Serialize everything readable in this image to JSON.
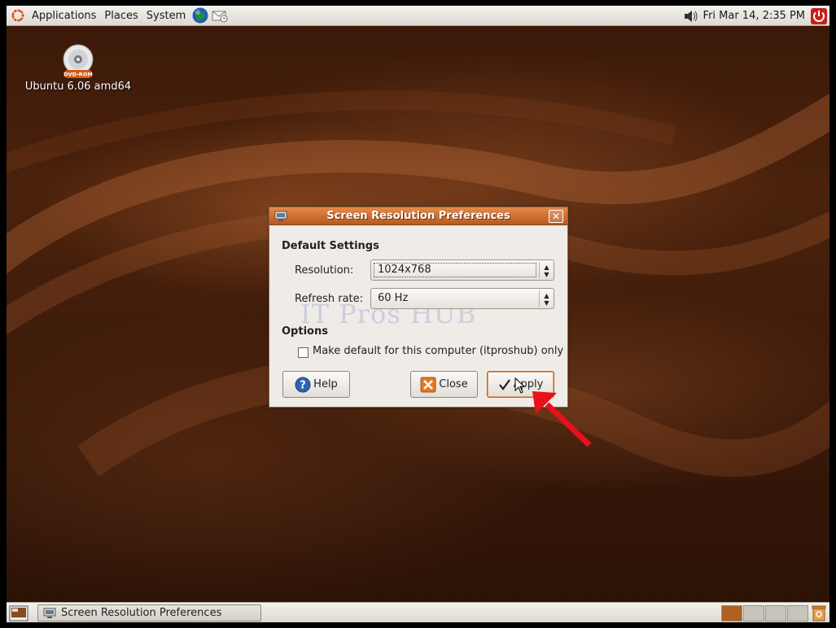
{
  "top_panel": {
    "menus": [
      "Applications",
      "Places",
      "System"
    ],
    "clock": "Fri Mar 14,  2:35 PM"
  },
  "desktop": {
    "icon_badge": "DVD-ROM",
    "icon_label": "Ubuntu 6.06 amd64",
    "watermark": "IT Pros HUB"
  },
  "dialog": {
    "title": "Screen Resolution Preferences",
    "default_settings_title": "Default Settings",
    "resolution_label": "Resolution:",
    "resolution_value": "1024x768",
    "refresh_label": "Refresh rate:",
    "refresh_value": "60 Hz",
    "options_title": "Options",
    "make_default_label": "Make default for this computer (itproshub) only",
    "make_default_checked": false,
    "help_label": "Help",
    "close_label": "Close",
    "apply_label": "Apply"
  },
  "bottom_panel": {
    "task_label": "Screen Resolution Preferences",
    "active_workspace": 1,
    "workspace_count": 4
  },
  "colors": {
    "accent": "#c86a2a",
    "title_gradient_top": "#e48a4a",
    "annotation_arrow": "#e8101a"
  }
}
